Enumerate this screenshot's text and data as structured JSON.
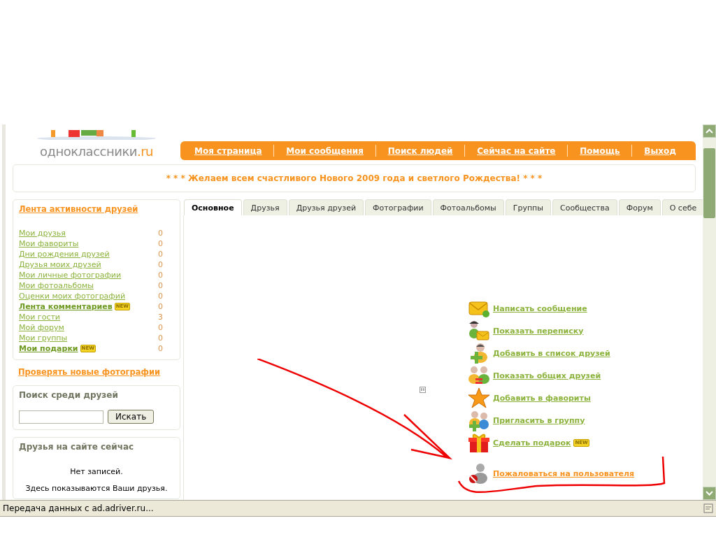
{
  "logo": {
    "text": "одноклассники",
    "suffix": ".ru"
  },
  "nav": [
    {
      "label": "Моя страница"
    },
    {
      "label": "Мои сообщения"
    },
    {
      "label": "Поиск людей"
    },
    {
      "label": "Сейчас на сайте"
    },
    {
      "label": "Помощь"
    },
    {
      "label": "Выход"
    }
  ],
  "banner": "* * * Желаем всем счастливого Нового 2009 года и светлого Рождества! * * *",
  "activity": {
    "title": "Лента активности друзей",
    "items": [
      {
        "label": "Мои друзья",
        "count": "0",
        "bold": false
      },
      {
        "label": "Мои фавориты",
        "count": "0",
        "bold": false
      },
      {
        "label": "Дни рождения друзей",
        "count": "0",
        "bold": false
      },
      {
        "label": "Друзья моих друзей",
        "count": "0",
        "bold": false
      },
      {
        "label": "Мои личные фотографии",
        "count": "0",
        "bold": false
      },
      {
        "label": "Мои фотоальбомы",
        "count": "0",
        "bold": false
      },
      {
        "label": "Оценки моих фотографий",
        "count": "0",
        "bold": false
      },
      {
        "label": "Лента комментариев",
        "count": "0",
        "bold": true,
        "badge": "NEW"
      },
      {
        "label": "Мои гости",
        "count": "3",
        "bold": false
      },
      {
        "label": "Мой форум",
        "count": "0",
        "bold": false
      },
      {
        "label": "Мои группы",
        "count": "0",
        "bold": false
      },
      {
        "label": "Мои подарки",
        "count": "0",
        "bold": true,
        "badge": "NEW"
      }
    ]
  },
  "check_photos": "Проверять новые фотографии",
  "friend_search": {
    "title": "Поиск среди друзей",
    "button": "Искать"
  },
  "online": {
    "title": "Друзья на сайте сейчас",
    "empty": "Нет записей.",
    "hint": "Здесь показываются Ваши друзья."
  },
  "tabs": [
    {
      "label": "Основное",
      "selected": true
    },
    {
      "label": "Друзья",
      "selected": false
    },
    {
      "label": "Друзья друзей",
      "selected": false
    },
    {
      "label": "Фотографии",
      "selected": false
    },
    {
      "label": "Фотоальбомы",
      "selected": false
    },
    {
      "label": "Группы",
      "selected": false
    },
    {
      "label": "Сообщества",
      "selected": false
    },
    {
      "label": "Форум",
      "selected": false
    },
    {
      "label": "О себе",
      "selected": false
    }
  ],
  "actions": [
    {
      "kind": "message",
      "label": "Написать сообщение"
    },
    {
      "kind": "correspondence",
      "label": "Показать переписку"
    },
    {
      "kind": "add-friend",
      "label": "Добавить в список друзей"
    },
    {
      "kind": "common-friends",
      "label": "Показать общих друзей"
    },
    {
      "kind": "favorite",
      "label": "Добавить в фавориты"
    },
    {
      "kind": "invite",
      "label": "Пригласить в группу"
    },
    {
      "kind": "gift",
      "label": "Сделать подарок",
      "badge": "NEW"
    },
    {
      "kind": "report",
      "label": "Пожаловаться на пользователя"
    }
  ],
  "status_bar": "Передача данных с ad.adriver.ru..."
}
